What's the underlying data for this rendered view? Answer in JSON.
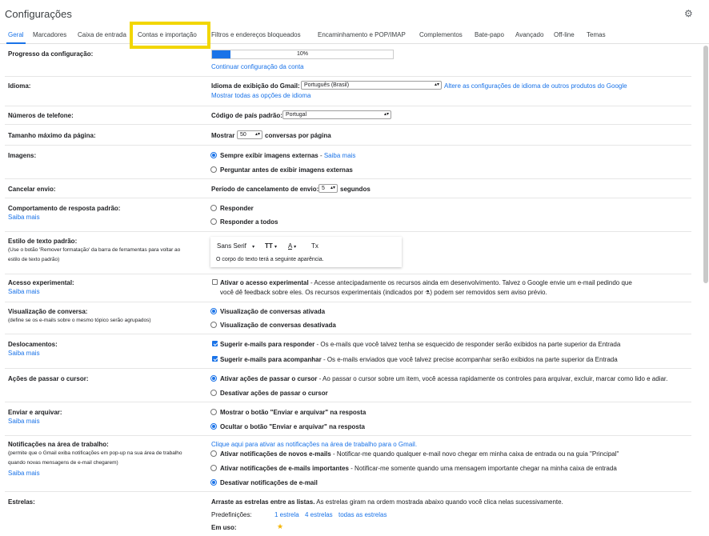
{
  "header": {
    "title": "Configurações",
    "settings_icon": "gear-icon"
  },
  "tabs": [
    {
      "label": "Geral",
      "active": true
    },
    {
      "label": "Marcadores"
    },
    {
      "label": "Caixa de entrada"
    },
    {
      "label": "Contas e importação",
      "highlighted": true
    },
    {
      "label": "Filtros e endereços bloqueados"
    },
    {
      "label": "Encaminhamento e POP/IMAP"
    },
    {
      "label": "Complementos"
    },
    {
      "label": "Bate-papo"
    },
    {
      "label": "Avançado"
    },
    {
      "label": "Off-line"
    },
    {
      "label": "Temas"
    }
  ],
  "colors": {
    "accent": "#1a73e8",
    "highlight": "#f2d600"
  },
  "progress": {
    "label": "Progresso da configuração:",
    "value": 10,
    "text": "10%",
    "link": "Continuar configuração da conta"
  },
  "language": {
    "label": "Idioma:",
    "field_label": "Idioma de exibição do Gmail:",
    "selected": "Português (Brasil)",
    "link_other": "Altere as configurações de idioma de outros produtos do Google",
    "link_all": "Mostrar todas as opções de idioma"
  },
  "phone": {
    "label": "Números de telefone:",
    "field_label": "Código de país padrão:",
    "selected": "Portugal"
  },
  "page_size": {
    "label": "Tamanho máximo da página:",
    "prefix": "Mostrar",
    "selected": "50",
    "suffix": "conversas por página"
  },
  "images": {
    "label": "Imagens:",
    "option1": "Sempre exibir imagens externas",
    "option1_sep": " - ",
    "option1_link": "Saiba mais",
    "option2": "Perguntar antes de exibir imagens externas"
  },
  "undo_send": {
    "label": "Cancelar envio:",
    "field_label": "Período de cancelamento de envio:",
    "selected": "5",
    "suffix": "segundos"
  },
  "reply": {
    "label": "Comportamento de resposta padrão:",
    "learn_more": "Saiba mais",
    "option1": "Responder",
    "option2": "Responder a todos"
  },
  "text_style": {
    "label": "Estilo de texto padrão:",
    "sub1": "(Use o botão 'Remover formatação' da barra de ferramentas para voltar ao",
    "sub2": "estilo de texto padrão)",
    "font": "Sans Serif",
    "size_glyph": "TT",
    "color_glyph": "A",
    "remove_glyph": "Tx",
    "preview": "O corpo do texto terá a seguinte aparência."
  },
  "experimental": {
    "label": "Acesso experimental:",
    "learn_more": "Saiba mais",
    "option": "Ativar o acesso experimental",
    "desc1": " - Acesse antecipadamente os recursos ainda em desenvolvimento. Talvez o Google envie um e-mail pedindo que",
    "desc2a": "você dê feedback sobre eles.  Os recursos experimentais (indicados por ",
    "desc2b": ") podem ser removidos sem aviso prévio."
  },
  "conversation": {
    "label": "Visualização de conversa:",
    "sub": "(define se os e-mails sobre o mesmo tópico serão agrupados)",
    "option1": "Visualização de conversas ativada",
    "option2": "Visualização de conversas desativada"
  },
  "nudges": {
    "label": "Deslocamentos:",
    "learn_more": "Saiba mais",
    "option1": "Sugerir e-mails para responder",
    "option1_desc": " - Os e-mails que você talvez tenha se esquecido de responder serão exibidos na parte superior da Entrada",
    "option2": "Sugerir e-mails para acompanhar",
    "option2_desc": " - Os e-mails enviados que você talvez precise acompanhar serão exibidos na parte superior da Entrada"
  },
  "hover": {
    "label": "Ações de passar o cursor:",
    "option1": "Ativar ações de passar o cursor",
    "option1_desc": " - Ao passar o cursor sobre um item, você acessa rapidamente os controles para arquivar, excluir, marcar como lido e adiar.",
    "option2": "Desativar ações de passar o cursor"
  },
  "send_archive": {
    "label": "Enviar e arquivar:",
    "learn_more": "Saiba mais",
    "option1": "Mostrar o botão \"Enviar e arquivar\" na resposta",
    "option2": "Ocultar o botão \"Enviar e arquivar\" na resposta"
  },
  "notifications": {
    "label": "Notificações na área de trabalho:",
    "sub1": "(permite que o Gmail exiba notificações em pop-up na sua área de trabalho",
    "sub2": "quando novas mensagens de e-mail chegarem)",
    "learn_more": "Saiba mais",
    "link": "Clique aqui para ativar as notificações na área de trabalho para o Gmail.",
    "option1": "Ativar notificações de novos e-mails",
    "option1_desc": " - Notificar-me quando qualquer e-mail novo chegar em minha caixa de entrada ou na guia \"Principal\"",
    "option2": "Ativar notificações de e-mails importantes",
    "option2_desc": " - Notificar-me somente quando uma mensagem importante chegar na minha caixa de entrada",
    "option3": "Desativar notificações de e-mail"
  },
  "stars": {
    "label": "Estrelas:",
    "intro_bold": "Arraste as estrelas entre as listas.",
    "intro_rest": "  As estrelas giram na ordem mostrada abaixo quando você clica nelas sucessivamente.",
    "presets_label": "Predefinições:",
    "preset1": "1 estrela",
    "preset2": "4 estrelas",
    "preset3": "todas as estrelas",
    "in_use_label": "Em uso:"
  }
}
